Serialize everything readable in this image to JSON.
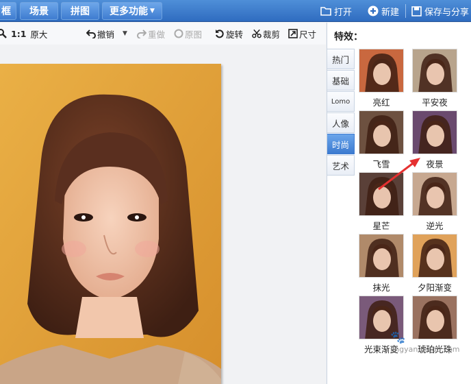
{
  "topbar": {
    "tabs": [
      {
        "label": "框"
      },
      {
        "label": "场景"
      },
      {
        "label": "拼图"
      },
      {
        "label": "更多功能"
      }
    ],
    "open_label": "打开",
    "new_label": "新建",
    "save_share_label": "保存与分享"
  },
  "toolbar": {
    "ratio_label": "1:1",
    "original_size_label": "原大",
    "undo_label": "撤销",
    "redo_label": "重做",
    "original_image_label": "原图",
    "rotate_label": "旋转",
    "crop_label": "裁剪",
    "size_label": "尺寸"
  },
  "panel": {
    "title": "特效：",
    "categories": [
      {
        "label": "热门"
      },
      {
        "label": "基础"
      },
      {
        "label": "Lomo"
      },
      {
        "label": "人像"
      },
      {
        "label": "时尚",
        "active": true
      },
      {
        "label": "艺术"
      }
    ],
    "effects": [
      {
        "label": "亮红",
        "tint": "#c9683f"
      },
      {
        "label": "平安夜",
        "tint": "#b8a48c"
      },
      {
        "label": "飞雪",
        "tint": "#6d5140"
      },
      {
        "label": "夜景",
        "tint": "#6a4a6e"
      },
      {
        "label": "星芒",
        "tint": "#5a4038"
      },
      {
        "label": "逆光",
        "tint": "#c7a890"
      },
      {
        "label": "抹光",
        "tint": "#b08a6a"
      },
      {
        "label": "夕阳渐变",
        "tint": "#e0a25a"
      },
      {
        "label": "光束渐变",
        "tint": "#7a5a7a"
      },
      {
        "label": "琥珀光珠",
        "tint": "#9a7260"
      }
    ]
  },
  "colors": {
    "accent": "#3d7bd0",
    "photo_bg": "#e3a53a",
    "hair": "#5a2f1f",
    "arrow": "#e53030"
  },
  "watermark": {
    "text": "jingyan.baidu.com"
  }
}
